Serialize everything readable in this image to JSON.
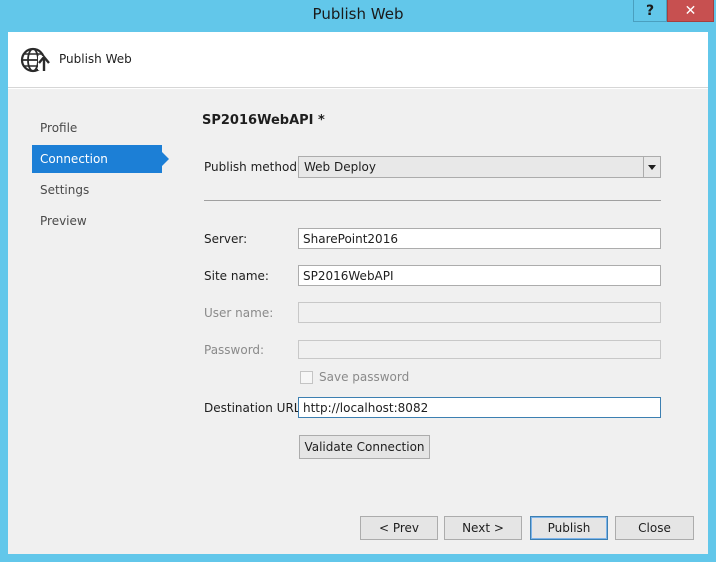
{
  "window": {
    "title": "Publish Web",
    "help_label": "?",
    "close_label": "✕"
  },
  "header": {
    "title": "Publish Web",
    "icon": "globe-publish-icon"
  },
  "nav": {
    "items": [
      {
        "label": "Profile",
        "active": false
      },
      {
        "label": "Connection",
        "active": true
      },
      {
        "label": "Settings",
        "active": false
      },
      {
        "label": "Preview",
        "active": false
      }
    ]
  },
  "form": {
    "profile_name": "SP2016WebAPI *",
    "publish_method": {
      "label": "Publish method:",
      "value": "Web Deploy"
    },
    "server": {
      "label": "Server:",
      "value": "SharePoint2016"
    },
    "site_name": {
      "label": "Site name:",
      "value": "SP2016WebAPI"
    },
    "user_name": {
      "label": "User name:",
      "value": ""
    },
    "password": {
      "label": "Password:",
      "value": ""
    },
    "save_password": {
      "label": "Save password",
      "checked": false
    },
    "destination_url": {
      "label": "Destination URL:",
      "value": "http://localhost:8082"
    },
    "validate_label": "Validate Connection"
  },
  "footer": {
    "prev_label": "< Prev",
    "next_label": "Next >",
    "publish_label": "Publish",
    "close_label": "Close"
  },
  "colors": {
    "frame": "#62c7ea",
    "nav_active": "#1c7fd6",
    "close_button": "#c75050"
  }
}
